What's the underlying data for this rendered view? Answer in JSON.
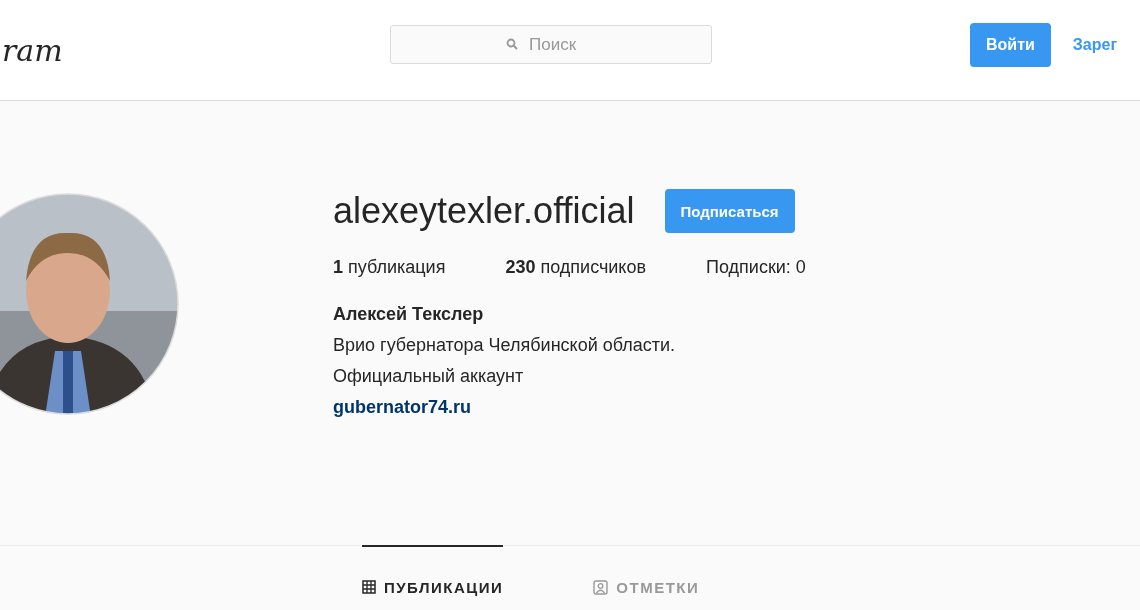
{
  "header": {
    "logo": "ram",
    "search": {
      "placeholder": "Поиск"
    },
    "login_button": "Войти",
    "register_link": "Зарег"
  },
  "profile": {
    "avatar": {
      "kind": "picture"
    },
    "username": "alexeytexler.official",
    "follow_button": "Подписаться",
    "stats": [
      "**1** публикация",
      "**230** подписчиков",
      "Подписки: 0"
    ],
    "full_name": "Алексей Текслер",
    "bio": [
      "Врио губернатора Челябинской области.",
      "Официальный аккаунт"
    ],
    "link": "gubernator74.ru"
  },
  "tabs": [
    {
      "label": "ПУБЛИКАЦИИ",
      "kind": "grid",
      "selected": true
    },
    {
      "label": "ОТМЕТКИ",
      "kind": "tag",
      "selected": false
    }
  ]
}
